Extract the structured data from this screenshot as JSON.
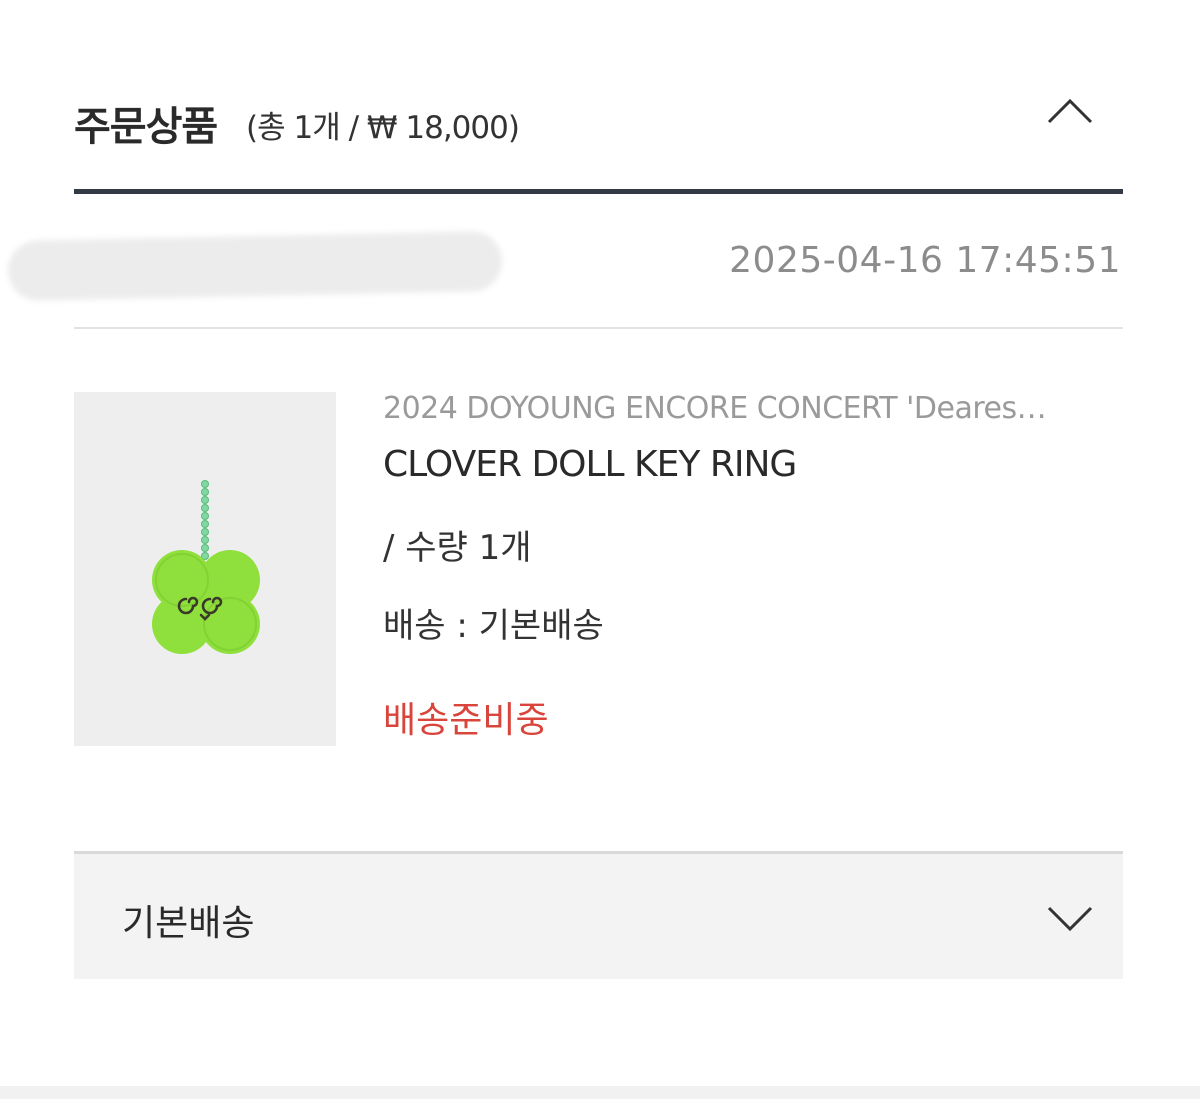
{
  "order_items": {
    "title": "주문상품",
    "summary": "(총 1개 / ₩ 18,000)",
    "collapse_icon": "chevron-up-icon"
  },
  "order": {
    "date": "2025-04-16 17:45:51"
  },
  "product": {
    "series": "2024 DOYOUNG ENCORE CONCERT 'Deares…",
    "name": "CLOVER DOLL KEY RING",
    "quantity": "/ 수량 1개",
    "shipping": "배송 : 기본배송",
    "status": "배송준비중",
    "status_color": "#d9443b",
    "image_icon": "clover-keyring-image"
  },
  "delivery": {
    "label": "기본배송",
    "expand_icon": "chevron-down-icon"
  }
}
